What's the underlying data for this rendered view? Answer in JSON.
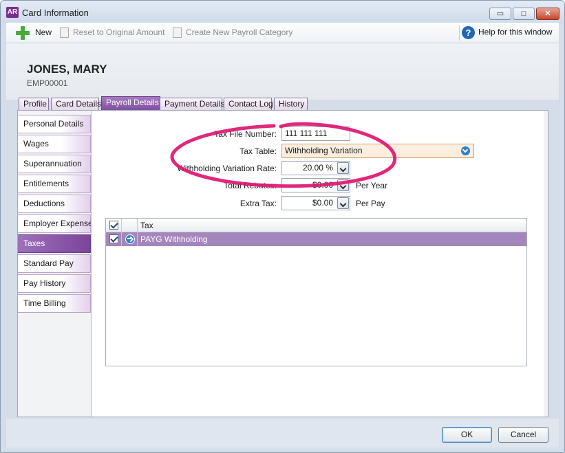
{
  "window": {
    "app_badge": "AR",
    "title": "Card Information",
    "controls": {
      "minimize": "▭",
      "maximize": "□",
      "close": "✕"
    }
  },
  "toolbar": {
    "new_label": "New",
    "reset_label": "Reset to Original Amount",
    "create_category_label": "Create New Payroll Category",
    "help_label": "Help for this window"
  },
  "header": {
    "card_name": "JONES, MARY",
    "card_id": "EMP00001"
  },
  "tabs": [
    {
      "label": "Profile"
    },
    {
      "label": "Card Details"
    },
    {
      "label": "Payroll Details"
    },
    {
      "label": "Payment Details"
    },
    {
      "label": "Contact Log"
    },
    {
      "label": "History"
    }
  ],
  "active_tab": "Payroll Details",
  "nav": [
    {
      "label": "Personal Details"
    },
    {
      "label": "Wages"
    },
    {
      "label": "Superannuation"
    },
    {
      "label": "Entitlements"
    },
    {
      "label": "Deductions"
    },
    {
      "label": "Employer Expenses"
    },
    {
      "label": "Taxes"
    },
    {
      "label": "Standard Pay"
    },
    {
      "label": "Pay History"
    },
    {
      "label": "Time Billing"
    }
  ],
  "active_nav": "Taxes",
  "form": {
    "tfn_label": "Tax File Number:",
    "tfn_value": "111 111 111",
    "tax_table_label": "Tax Table:",
    "tax_table_value": "Withholding Variation",
    "variation_rate_label": "Withholding Variation Rate:",
    "variation_rate_value": "20.00 %",
    "total_rebates_label": "Total Rebates:",
    "total_rebates_value": "$0.00",
    "total_rebates_suffix": "Per Year",
    "extra_tax_label": "Extra Tax:",
    "extra_tax_value": "$0.00",
    "extra_tax_suffix": "Per Pay"
  },
  "grid": {
    "column_header": "Tax",
    "rows": [
      {
        "checked": true,
        "label": "PAYG Withholding"
      }
    ]
  },
  "footer": {
    "ok_label": "OK",
    "cancel_label": "Cancel"
  },
  "colors": {
    "accent_purple": "#7f4b9f",
    "selected_row": "#a486bc",
    "annotation_pink": "#e0166f",
    "combo_highlight": "#fdeee0"
  }
}
